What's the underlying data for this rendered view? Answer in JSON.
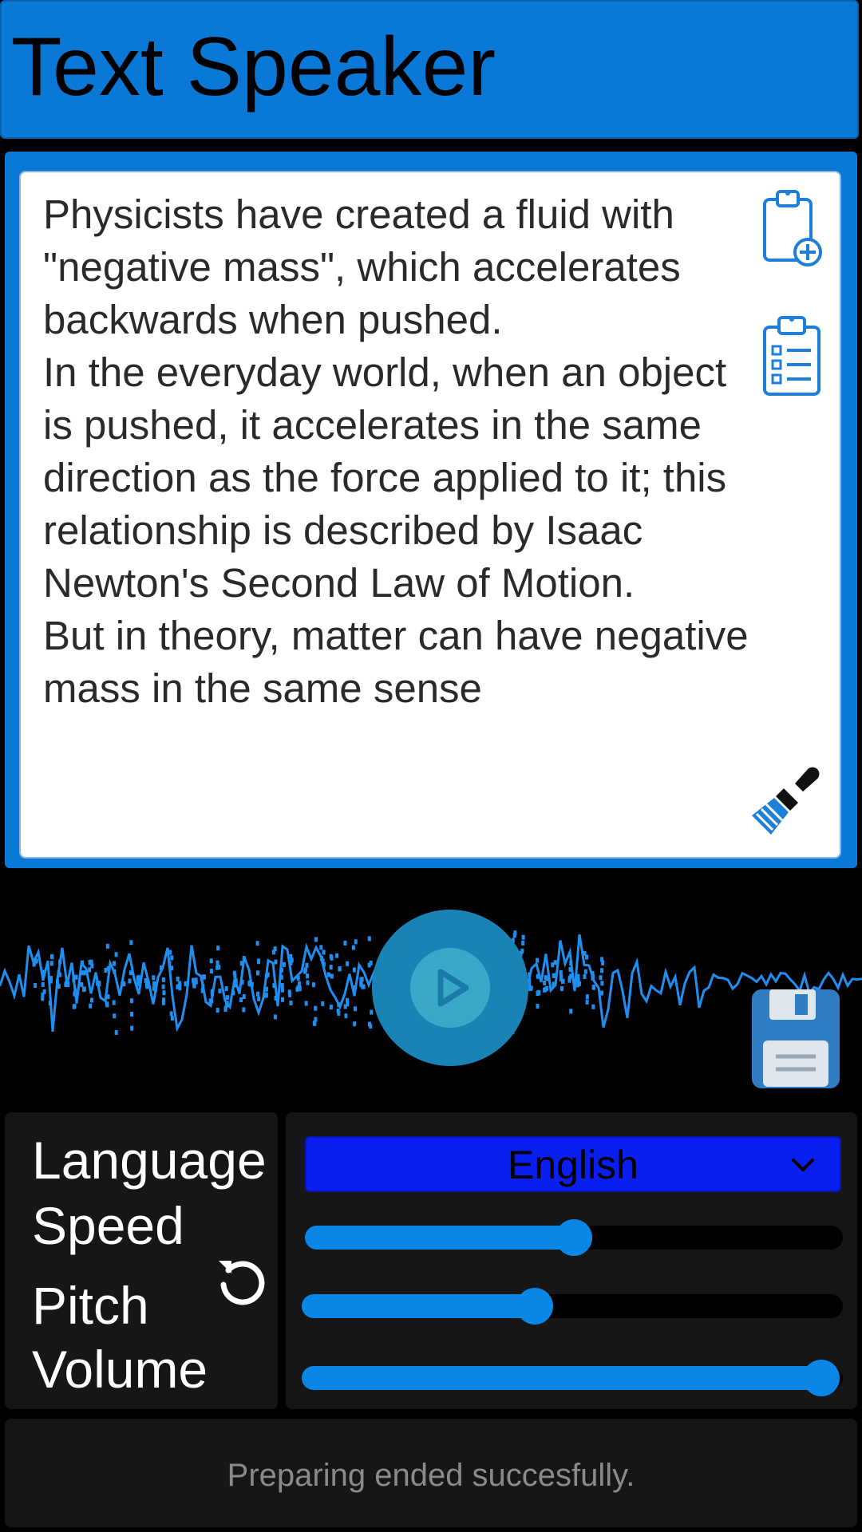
{
  "app": {
    "title": "Text Speaker"
  },
  "editor": {
    "text": "Physicists have created a fluid with \"negative mass\", which accelerates backwards when pushed.\nIn the everyday world, when an object is pushed, it accelerates in the same direction as the force applied to it; this relationship is described by Isaac Newton's Second Law of Motion.\nBut in theory, matter can have negative mass in the same sense"
  },
  "icons": {
    "paste": "clipboard-add-icon",
    "list": "clipboard-list-icon",
    "clear": "broom-icon",
    "play": "play-icon",
    "save": "floppy-disk-icon",
    "reset": "reset-icon"
  },
  "settings": {
    "language_label": "Language",
    "speed_label": "Speed",
    "pitch_label": "Pitch",
    "volume_label": "Volume",
    "language_value": "English",
    "speed": 0.5,
    "pitch": 0.43,
    "volume": 0.96
  },
  "status": {
    "message": "Preparing ended succesfully."
  },
  "colors": {
    "accent": "#0a78d6",
    "select": "#0a1ef0",
    "slider": "#0a86e6",
    "wave": "#1e8ff0"
  }
}
